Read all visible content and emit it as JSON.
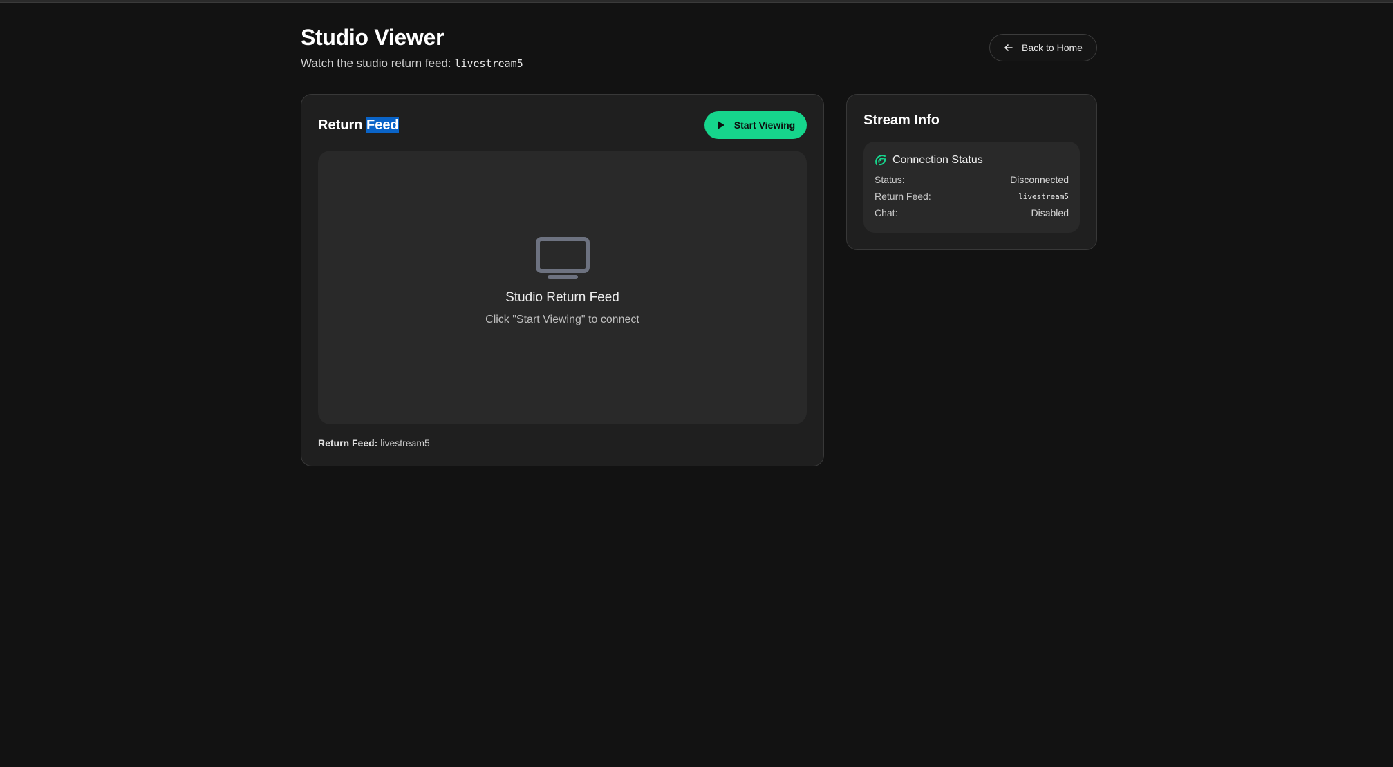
{
  "header": {
    "title": "Studio Viewer",
    "subtitle_prefix": "Watch the studio return feed:",
    "stream_key": "livestream5",
    "back_label": "Back to Home"
  },
  "feed_card": {
    "title_part1": "Return",
    "title_part2": "Feed",
    "start_label": "Start Viewing",
    "placeholder_title": "Studio Return Feed",
    "placeholder_sub": "Click \"Start Viewing\" to connect",
    "footer_label": "Return Feed:",
    "footer_value": "livestream5"
  },
  "info_card": {
    "title": "Stream Info",
    "connection_title": "Connection Status",
    "rows": [
      {
        "label": "Status:",
        "value": "Disconnected"
      },
      {
        "label": "Return Feed:",
        "value": "livestream5"
      },
      {
        "label": "Chat:",
        "value": "Disabled"
      }
    ]
  },
  "colors": {
    "accent": "#16d58c",
    "background": "#121212",
    "card": "#1f1f1f",
    "selection": "#0a64c8"
  },
  "icons": {
    "back": "arrow-left-icon",
    "play": "play-icon",
    "tv": "tv-icon",
    "connection": "signal-icon"
  }
}
